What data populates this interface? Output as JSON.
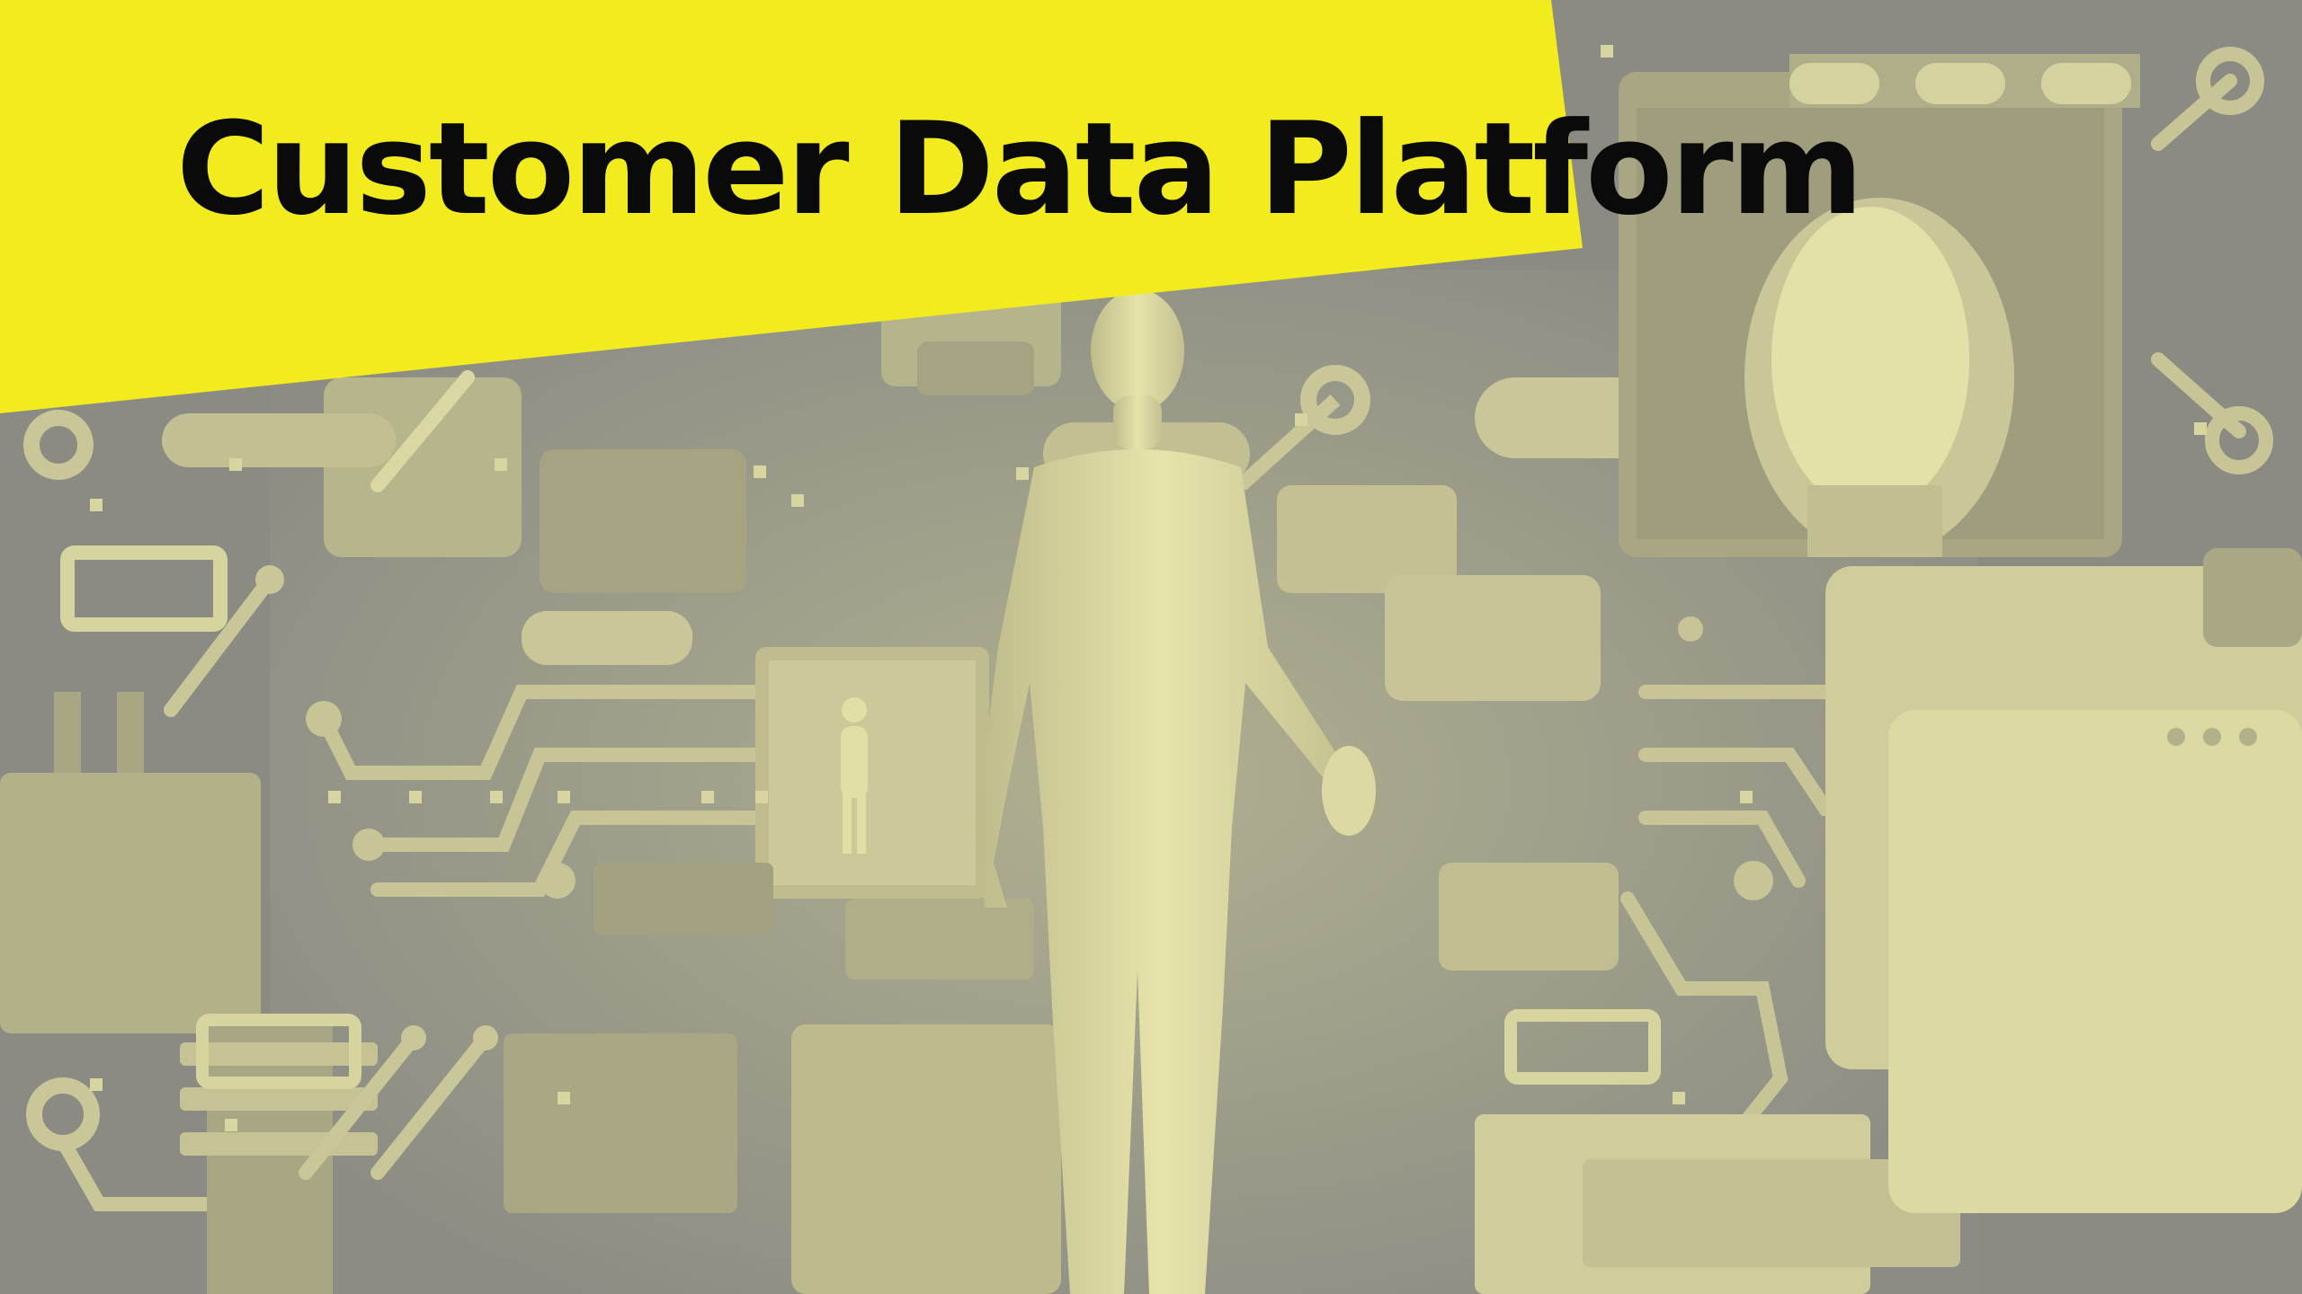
{
  "title": "Customer Data Platform",
  "colors": {
    "banner": "#f2eb1e",
    "background": "#8d8d85",
    "pale": "#e0dea4",
    "mid": "#b9b78f",
    "dark": "#7a7a74"
  },
  "illustration": {
    "description_icons": [
      "human-figure-icon",
      "face-portrait-icon",
      "circuit-board-icon",
      "browser-window-icon"
    ]
  }
}
